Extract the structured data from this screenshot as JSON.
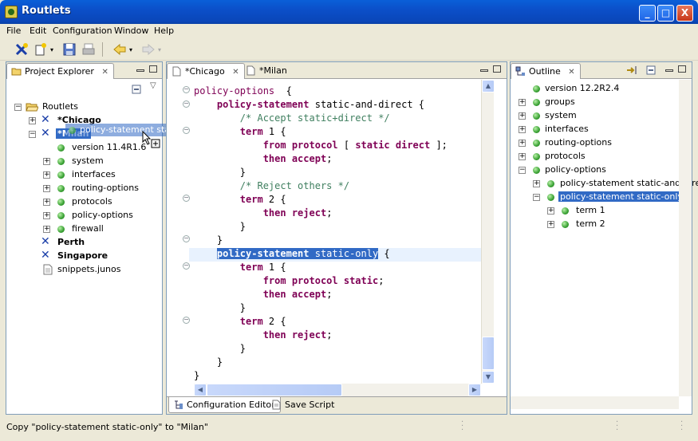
{
  "window": {
    "title": "Routlets",
    "min": "_",
    "max": "□",
    "close": "X"
  },
  "menu": [
    "File",
    "Edit",
    "Configuration",
    "Window",
    "Help"
  ],
  "project_explorer": {
    "tab_label": "Project Explorer",
    "close": "✕",
    "root": "Routlets",
    "nodes": {
      "chicago": "*Chicago",
      "milan": "*Milan",
      "version": "version 11.4R1.6",
      "system": "system",
      "interfaces": "interfaces",
      "routing_options": "routing-options",
      "protocols": "protocols",
      "policy_options": "policy-options",
      "firewall": "firewall",
      "perth": "Perth",
      "singapore": "Singapore",
      "snippets": "snippets.junos"
    },
    "drag_label": "policy-statement static-only"
  },
  "editor": {
    "tabs": [
      {
        "label": "*Chicago",
        "close": "✕"
      },
      {
        "label": "*Milan"
      }
    ],
    "bottom_tabs": [
      "Configuration Editor",
      "Save Script"
    ]
  },
  "outline": {
    "tab_label": "Outline",
    "close": "✕",
    "items": {
      "version": "version 12.2R2.4",
      "groups": "groups",
      "system": "system",
      "interfaces": "interfaces",
      "routing_options": "routing-options",
      "protocols": "protocols",
      "policy_options": "policy-options",
      "ps_and_direct": "policy-statement static-and-direct",
      "ps_only": "policy-statement static-only",
      "term1": "term 1",
      "term2": "term 2"
    }
  },
  "status": {
    "message": "Copy \"policy-statement static-only\" to \"Milan\""
  },
  "code_lines": [
    [
      [
        "pl",
        "policy-options"
      ],
      [
        "",
        "  {"
      ]
    ],
    [
      [
        "",
        "    "
      ],
      [
        "kw",
        "policy-statement"
      ],
      [
        "",
        " static-and-direct {"
      ]
    ],
    [
      [
        "",
        "        "
      ],
      [
        "cm",
        "/* Accept static+direct */"
      ]
    ],
    [
      [
        "",
        "        "
      ],
      [
        "kw",
        "term"
      ],
      [
        "",
        " 1 {"
      ]
    ],
    [
      [
        "",
        "            "
      ],
      [
        "kw",
        "from protocol"
      ],
      [
        "",
        " [ "
      ],
      [
        "kw",
        "static direct"
      ],
      [
        "",
        " ];"
      ]
    ],
    [
      [
        "",
        "            "
      ],
      [
        "kw",
        "then accept"
      ],
      [
        "",
        ";"
      ]
    ],
    [
      [
        "",
        "        }"
      ]
    ],
    [
      [
        "",
        "        "
      ],
      [
        "cm",
        "/* Reject others */"
      ]
    ],
    [
      [
        "",
        "        "
      ],
      [
        "kw",
        "term"
      ],
      [
        "",
        " 2 {"
      ]
    ],
    [
      [
        "",
        "            "
      ],
      [
        "kw",
        "then reject"
      ],
      [
        "",
        ";"
      ]
    ],
    [
      [
        "",
        "        }"
      ]
    ],
    [
      [
        "",
        "    }"
      ]
    ],
    [
      [
        "",
        "    "
      ],
      [
        "hl-kw",
        "policy-statement"
      ],
      [
        "hl",
        " static-only"
      ],
      [
        "",
        " {"
      ]
    ],
    [
      [
        "",
        "        "
      ],
      [
        "kw",
        "term"
      ],
      [
        "",
        " 1 {"
      ]
    ],
    [
      [
        "",
        "            "
      ],
      [
        "kw",
        "from protocol static"
      ],
      [
        "",
        ";"
      ]
    ],
    [
      [
        "",
        "            "
      ],
      [
        "kw",
        "then accept"
      ],
      [
        "",
        ";"
      ]
    ],
    [
      [
        "",
        "        }"
      ]
    ],
    [
      [
        "",
        "        "
      ],
      [
        "kw",
        "term"
      ],
      [
        "",
        " 2 {"
      ]
    ],
    [
      [
        "",
        "            "
      ],
      [
        "kw",
        "then reject"
      ],
      [
        "",
        ";"
      ]
    ],
    [
      [
        "",
        "        }"
      ]
    ],
    [
      [
        "",
        "    }"
      ]
    ],
    [
      [
        "",
        "}"
      ]
    ]
  ]
}
